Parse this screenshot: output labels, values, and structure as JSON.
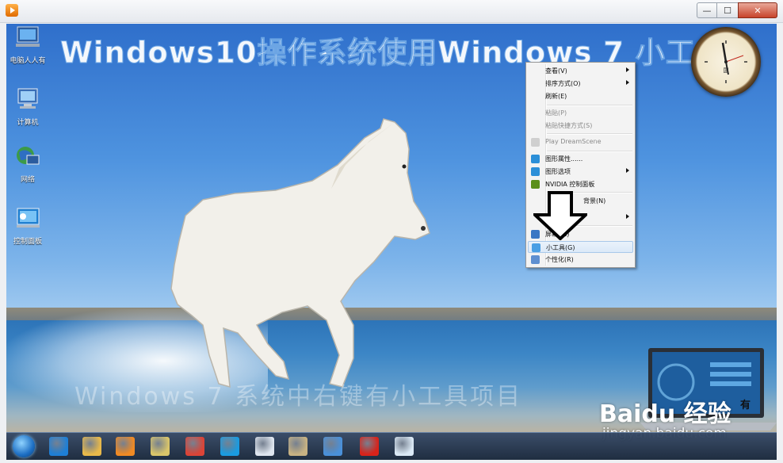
{
  "window": {
    "controls": {
      "minimize": "—",
      "maximize": "☐",
      "close": "✕"
    },
    "close_color": "#c7432a"
  },
  "desktop": {
    "title": "Windows10操作系统使用Windows 7 小工具",
    "icons": [
      {
        "label": "电脑人人有",
        "icon": "monitor-icon"
      },
      {
        "label": "计算机",
        "icon": "computer-icon"
      },
      {
        "label": "网络",
        "icon": "network-icon"
      },
      {
        "label": "控制面板",
        "icon": "control-panel-icon"
      }
    ],
    "clock_brand": "国"
  },
  "context_menu": {
    "items": [
      {
        "label": "查看(V)",
        "submenu": true,
        "disabled": false
      },
      {
        "label": "排序方式(O)",
        "submenu": true,
        "disabled": false
      },
      {
        "label": "刷新(E)",
        "submenu": false,
        "disabled": false
      },
      {
        "label": "粘贴(P)",
        "submenu": false,
        "disabled": true
      },
      {
        "label": "粘贴快捷方式(S)",
        "submenu": false,
        "disabled": true
      },
      {
        "label": "Play DreamScene",
        "submenu": false,
        "disabled": true
      },
      {
        "label": "图形属性......",
        "submenu": false,
        "disabled": false
      },
      {
        "label": "图形选项",
        "submenu": true,
        "disabled": false
      },
      {
        "label": "NVIDIA 控制面板",
        "submenu": false,
        "disabled": false
      },
      {
        "label": "背景(N)",
        "submenu": false,
        "disabled": false
      },
      {
        "label": "",
        "submenu": true,
        "disabled": false
      },
      {
        "label": "屏幕 (C)",
        "submenu": false,
        "disabled": false
      },
      {
        "label": "小工具(G)",
        "submenu": false,
        "disabled": false,
        "highlighted": true
      },
      {
        "label": "个性化(R)",
        "submenu": false,
        "disabled": false
      }
    ]
  },
  "overlays": {
    "watermark_text": "Windows 7 系统中右键有小工具项目",
    "baidu_logo": "Baidu 经验",
    "site": "jingyan.baidu.com",
    "laptop_caption": "有"
  },
  "taskbar": {
    "items": [
      {
        "name": "ie-icon",
        "color": "#1e7fd6"
      },
      {
        "name": "folder-icon",
        "color": "#e8b94a"
      },
      {
        "name": "media-player-icon",
        "color": "#f08a24"
      },
      {
        "name": "notes-icon",
        "color": "#d9c56a"
      },
      {
        "name": "chrome-icon",
        "color": "#db4437"
      },
      {
        "name": "browser-icon",
        "color": "#1a9be0"
      },
      {
        "name": "document-icon",
        "color": "#dfe6ef"
      },
      {
        "name": "paint-icon",
        "color": "#c7b283"
      },
      {
        "name": "screen-tool-icon",
        "color": "#4a90d9"
      },
      {
        "name": "chess-icon",
        "color": "#d8231a"
      },
      {
        "name": "flower-icon",
        "color": "#dbe9f5"
      }
    ]
  }
}
